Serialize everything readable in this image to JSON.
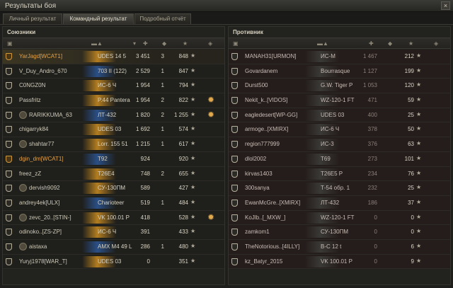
{
  "window": {
    "title": "Результаты боя",
    "close": "×"
  },
  "tabs": [
    "Личный результат",
    "Командный результат",
    "Подробный отчёт"
  ],
  "allies": {
    "title": "Союзники",
    "rows": [
      {
        "name": "YarJagd[WCAT1]",
        "tank": "UDES 14 5",
        "damage": "3 451",
        "frags": "3",
        "xp": "848",
        "gold": true,
        "me": true,
        "medal": false,
        "squad": false
      },
      {
        "name": "V_Duy_Andro_670",
        "tank": "703 II (122)",
        "damage": "2 529",
        "frags": "1",
        "xp": "847",
        "gold": false,
        "me": false,
        "medal": false,
        "squad": false
      },
      {
        "name": "C0NGZ0N",
        "tank": "ИС-6 Ч",
        "damage": "1 954",
        "frags": "1",
        "xp": "794",
        "gold": false,
        "me": false,
        "medal": false,
        "squad": false
      },
      {
        "name": "Passfritz",
        "tank": "P.44 Pantera",
        "damage": "1 954",
        "frags": "2",
        "xp": "822",
        "gold": false,
        "me": false,
        "medal": true,
        "squad": false
      },
      {
        "name": "RARIKKUMA_63",
        "tank": "ЛТ-432",
        "damage": "1 820",
        "frags": "2",
        "xp": "1 255",
        "gold": false,
        "me": false,
        "medal": true,
        "squad": true
      },
      {
        "name": "chigarryk84",
        "tank": "UDES 03",
        "damage": "1 692",
        "frags": "1",
        "xp": "574",
        "gold": false,
        "me": false,
        "medal": false,
        "squad": false
      },
      {
        "name": "shahtar77",
        "tank": "Lorr. 155 51",
        "damage": "1 215",
        "frags": "1",
        "xp": "617",
        "gold": false,
        "me": false,
        "medal": false,
        "squad": true
      },
      {
        "name": "dgin_dm[WCAT1]",
        "tank": "T92",
        "damage": "924",
        "frags": "",
        "xp": "920",
        "gold": true,
        "me": false,
        "medal": false,
        "squad": false
      },
      {
        "name": "freez_zZ",
        "tank": "T26E4",
        "damage": "748",
        "frags": "2",
        "xp": "655",
        "gold": false,
        "me": false,
        "medal": false,
        "squad": false
      },
      {
        "name": "dervish9092",
        "tank": "СУ-130ПМ",
        "damage": "589",
        "frags": "",
        "xp": "427",
        "gold": false,
        "me": false,
        "medal": false,
        "squad": true
      },
      {
        "name": "andrey4ek[ULX]",
        "tank": "Charioteer",
        "damage": "519",
        "frags": "1",
        "xp": "484",
        "gold": false,
        "me": false,
        "medal": false,
        "squad": false
      },
      {
        "name": "zevc_20..[STIN-]",
        "tank": "VK 100.01 P",
        "damage": "418",
        "frags": "",
        "xp": "528",
        "gold": false,
        "me": false,
        "medal": true,
        "squad": true
      },
      {
        "name": "odinoko..[ZS-ZP]",
        "tank": "ИС-6 Ч",
        "damage": "391",
        "frags": "",
        "xp": "433",
        "gold": false,
        "me": false,
        "medal": false,
        "squad": false
      },
      {
        "name": "aistaxa",
        "tank": "AMX M4 49 L",
        "damage": "286",
        "frags": "1",
        "xp": "480",
        "gold": false,
        "me": false,
        "medal": false,
        "squad": true
      },
      {
        "name": "Yuryj1978[WAR_T]",
        "tank": "UDES 03",
        "damage": "0",
        "frags": "",
        "xp": "351",
        "gold": false,
        "me": false,
        "medal": false,
        "squad": false
      }
    ]
  },
  "enemies": {
    "title": "Противник",
    "rows": [
      {
        "name": "MANAH31[URMON]",
        "tank": "ИС-М",
        "damage": "1 467",
        "xp": "212"
      },
      {
        "name": "Govardanem",
        "tank": "Bourrasque",
        "damage": "1 127",
        "xp": "199"
      },
      {
        "name": "Durst500",
        "tank": "G.W. Tiger P",
        "damage": "1 053",
        "xp": "120"
      },
      {
        "name": "Nekit_k..[VIDOS]",
        "tank": "WZ-120-1 FT",
        "damage": "471",
        "xp": "59"
      },
      {
        "name": "eagledesert[WP-GG]",
        "tank": "UDES 03",
        "damage": "400",
        "xp": "25"
      },
      {
        "name": "armoge..[XMIRX]",
        "tank": "ИС-6 Ч",
        "damage": "378",
        "xp": "50"
      },
      {
        "name": "region777999",
        "tank": "ИС-3",
        "damage": "376",
        "xp": "63"
      },
      {
        "name": "dlol2002",
        "tank": "T69",
        "damage": "273",
        "xp": "101"
      },
      {
        "name": "kirvas1403",
        "tank": "T26E5 P",
        "damage": "234",
        "xp": "76"
      },
      {
        "name": "300sanya",
        "tank": "Т-54 обр. 1",
        "damage": "232",
        "xp": "25"
      },
      {
        "name": "EwanMcGre..[XMIRX]",
        "tank": "ЛТ-432",
        "damage": "186",
        "xp": "37"
      },
      {
        "name": "KoJlb..[_MXW_]",
        "tank": "WZ-120-1 FT",
        "damage": "0",
        "xp": "0"
      },
      {
        "name": "zamkom1",
        "tank": "СУ-130ПМ",
        "damage": "0",
        "xp": "0"
      },
      {
        "name": "TheNotorious..[4ILLY]",
        "tank": "В-С 12 t",
        "damage": "0",
        "xp": "6"
      },
      {
        "name": "kz_Batyr_2015",
        "tank": "VK 100.01 P",
        "damage": "0",
        "xp": "9"
      }
    ]
  },
  "colors": {
    "gold_name": "#e2a24a",
    "tank_gold": "#b37d20",
    "tank_blue": "#2a4f86"
  }
}
